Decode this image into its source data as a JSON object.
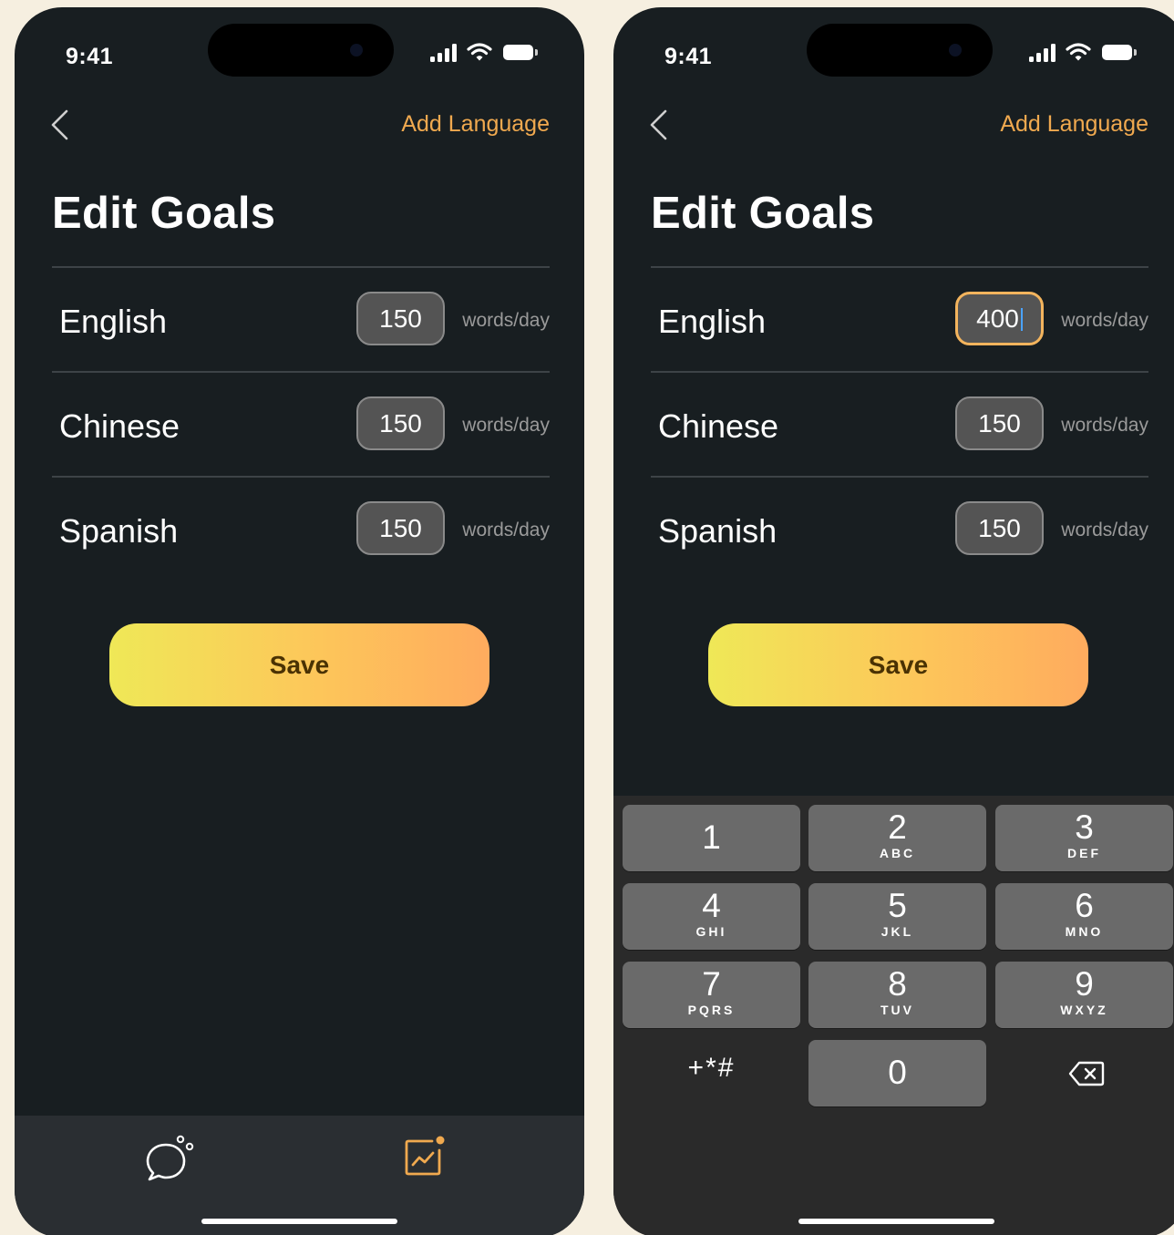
{
  "status_bar": {
    "time": "9:41"
  },
  "nav": {
    "add_language": "Add Language"
  },
  "page_title": "Edit Goals",
  "unit_label": "words/day",
  "left_screen": {
    "goals": [
      {
        "language": "English",
        "value": "150"
      },
      {
        "language": "Chinese",
        "value": "150"
      },
      {
        "language": "Spanish",
        "value": "150"
      }
    ]
  },
  "right_screen": {
    "goals": [
      {
        "language": "English",
        "value": "400"
      },
      {
        "language": "Chinese",
        "value": "150"
      },
      {
        "language": "Spanish",
        "value": "150"
      }
    ]
  },
  "save_label": "Save",
  "tabbar": {
    "tabs": [
      {
        "icon": "chat-bubble-icon"
      },
      {
        "icon": "progress-chart-icon"
      }
    ]
  },
  "keypad": {
    "keys": [
      {
        "num": "1",
        "letters": ""
      },
      {
        "num": "2",
        "letters": "ABC"
      },
      {
        "num": "3",
        "letters": "DEF"
      },
      {
        "num": "4",
        "letters": "GHI"
      },
      {
        "num": "5",
        "letters": "JKL"
      },
      {
        "num": "6",
        "letters": "MNO"
      },
      {
        "num": "7",
        "letters": "PQRS"
      },
      {
        "num": "8",
        "letters": "TUV"
      },
      {
        "num": "9",
        "letters": "WXYZ"
      },
      {
        "num": "+*#",
        "letters": ""
      },
      {
        "num": "0",
        "letters": ""
      }
    ]
  },
  "colors": {
    "accent": "#f0a94f",
    "background": "#181e21",
    "save_gradient_start": "#efe857",
    "save_gradient_end": "#feab5e"
  }
}
